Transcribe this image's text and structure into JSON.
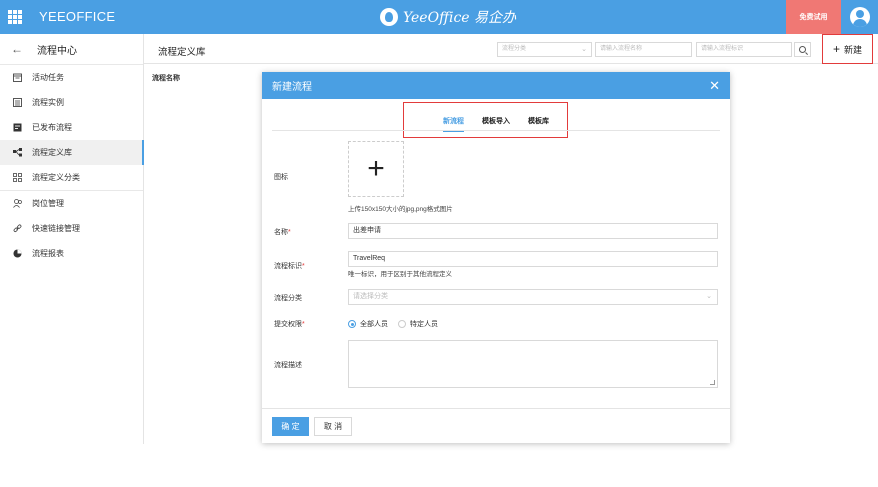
{
  "topbar": {
    "brand": "YEEOFFICE",
    "center_logo": "YeeOffice 易企办",
    "trial_label": "免费试用"
  },
  "sidebar": {
    "header": "流程中心",
    "items": [
      {
        "label": "活动任务",
        "icon": "calendar-icon"
      },
      {
        "label": "流程实例",
        "icon": "list-icon"
      },
      {
        "label": "已发布流程",
        "icon": "publish-icon"
      },
      {
        "label": "流程定义库",
        "icon": "flow-icon",
        "active": true
      },
      {
        "label": "流程定义分类",
        "icon": "grid-icon"
      },
      {
        "label": "岗位管理",
        "icon": "users-icon"
      },
      {
        "label": "快速链接管理",
        "icon": "link-icon"
      },
      {
        "label": "流程报表",
        "icon": "pie-chart-icon"
      }
    ]
  },
  "main": {
    "title": "流程定义库",
    "filter_category_placeholder": "流程分类",
    "filter_name_placeholder": "请输入流程名称",
    "filter_key_placeholder": "请输入流程标识",
    "new_label": "新建",
    "column_name": "流程名称"
  },
  "modal": {
    "title": "新建流程",
    "tabs": [
      "新流程",
      "模板导入",
      "模板库"
    ],
    "icon_label": "图标",
    "upload_hint": "上传150x150大小的jpg,png格式图片",
    "name_label": "名称",
    "name_value": "出差申请",
    "key_label": "流程标识",
    "key_value": "TravelReq",
    "key_hint": "唯一标识，用于区别于其他流程定义",
    "category_label": "流程分类",
    "category_placeholder": "请选择分类",
    "permission_label": "提交权限",
    "permission_options": [
      "全部人员",
      "特定人员"
    ],
    "desc_label": "流程描述",
    "ok_label": "确 定",
    "cancel_label": "取 消"
  }
}
